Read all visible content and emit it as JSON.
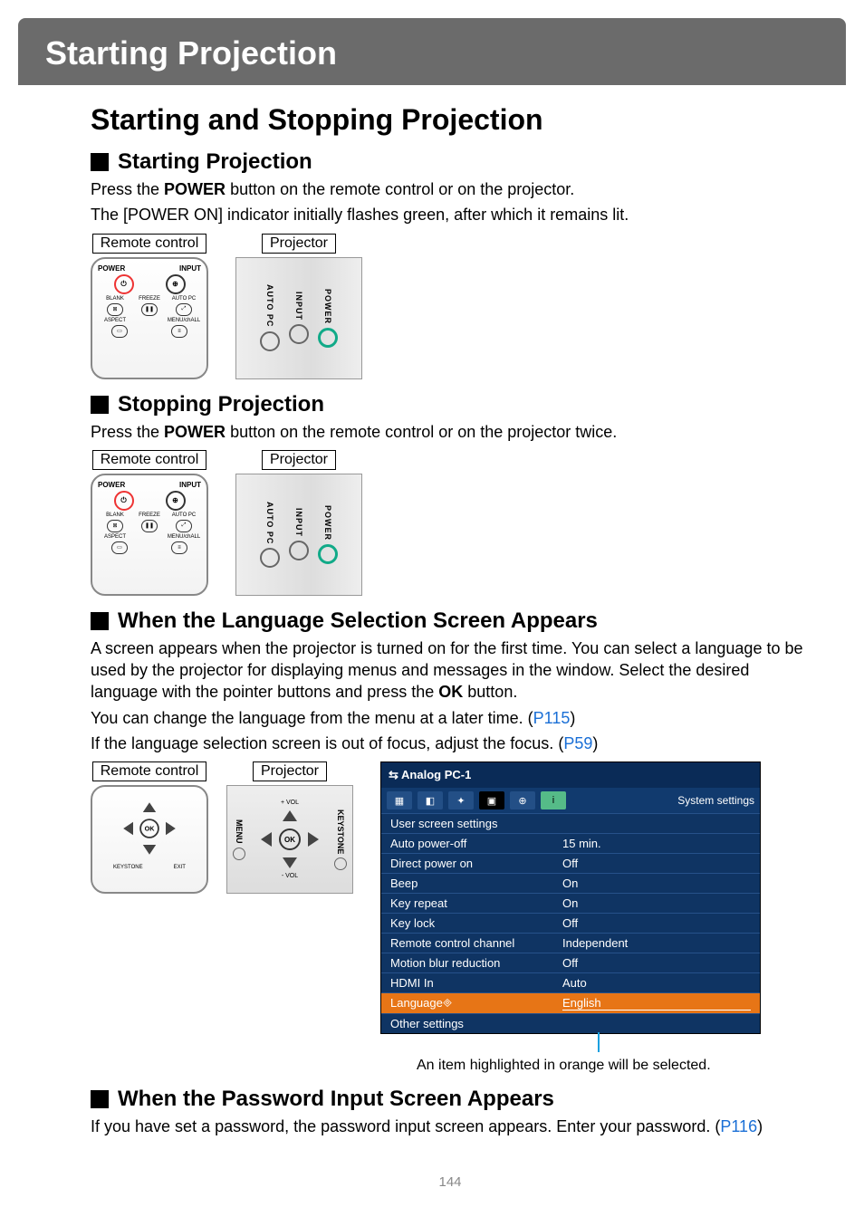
{
  "title_bar": "Starting Projection",
  "main_heading": "Starting and Stopping Projection",
  "sec_start": {
    "heading": "Starting Projection",
    "p1_a": "Press the ",
    "p1_bold": "POWER",
    "p1_b": " button on the remote control or on the projector.",
    "p2": "The [POWER ON] indicator initially flashes green, after which it remains lit."
  },
  "sec_stop": {
    "heading": "Stopping Projection",
    "p1_a": "Press the ",
    "p1_bold": "POWER",
    "p1_b": " button on the remote control or on the projector twice."
  },
  "sec_lang": {
    "heading": "When the Language Selection Screen Appears",
    "p1_a": "A screen appears when the projector is turned on for the first time. You can select a language to be used by the projector for displaying menus and messages in the window. Select the desired language with the pointer buttons and press the ",
    "p1_bold": "OK",
    "p1_b": " button.",
    "p2_a": "You can change the language from the menu at a later time. (",
    "p2_link": "P115",
    "p2_b": ")",
    "p3_a": "If the language selection screen is out of focus, adjust the focus. (",
    "p3_link": "P59",
    "p3_b": ")"
  },
  "sec_pwd": {
    "heading": "When the Password Input Screen Appears",
    "p1_a": "If you have set a password, the password input screen appears. Enter your password. (",
    "p1_link": "P116",
    "p1_b": ")"
  },
  "labels": {
    "remote": "Remote control",
    "projector": "Projector"
  },
  "remote_buttons": {
    "power": "POWER",
    "input": "INPUT",
    "blank": "BLANK",
    "freeze": "FREEZE",
    "autopc": "AUTO PC",
    "aspect": "ASPECT",
    "menu": "MENU/chALL",
    "ok": "OK",
    "keystone": "KEYSTONE",
    "exit": "EXIT"
  },
  "projector_labels": {
    "autopc": "AUTO PC",
    "input": "INPUT",
    "power": "POWER",
    "menu": "MENU",
    "keystone": "KEYSTONE",
    "ok": "OK",
    "vol_up": "+ VOL",
    "vol_down": "- VOL"
  },
  "menu": {
    "title_icon": "⇆",
    "title": "Analog PC-1",
    "right_label": "System settings",
    "rows": [
      {
        "k": "User screen settings",
        "v": ""
      },
      {
        "k": "Auto power-off",
        "v": "15 min."
      },
      {
        "k": "Direct power on",
        "v": "Off"
      },
      {
        "k": "Beep",
        "v": "On"
      },
      {
        "k": "Key repeat",
        "v": "On"
      },
      {
        "k": "Key lock",
        "v": "Off"
      },
      {
        "k": "Remote control channel",
        "v": "Independent"
      },
      {
        "k": "Motion blur reduction",
        "v": "Off"
      },
      {
        "k": "HDMI In",
        "v": "Auto"
      }
    ],
    "hl": {
      "k": "Language",
      "v": "English"
    },
    "last": {
      "k": "Other settings",
      "v": ""
    },
    "caption": "An item highlighted in orange will be selected."
  },
  "page_number": "144"
}
